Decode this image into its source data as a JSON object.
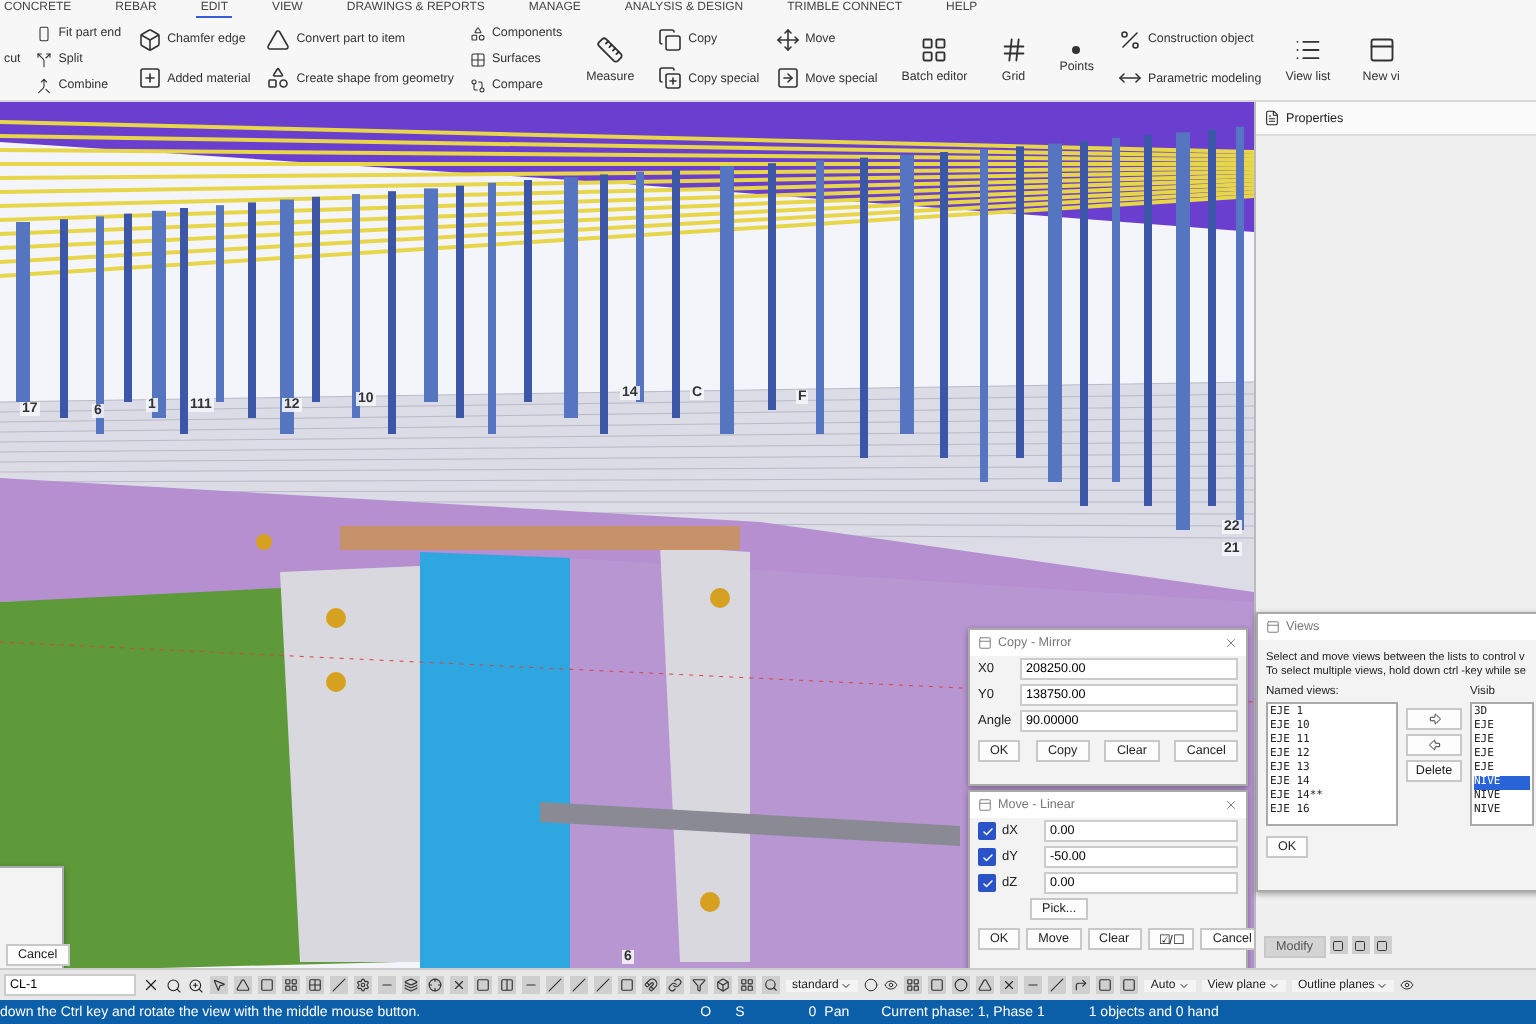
{
  "ribbon": {
    "tabs": [
      {
        "label": "CONCRETE",
        "selected": false
      },
      {
        "label": "REBAR",
        "selected": false
      },
      {
        "label": "EDIT",
        "selected": true
      },
      {
        "label": "VIEW",
        "selected": false
      },
      {
        "label": "DRAWINGS & REPORTS",
        "selected": false
      },
      {
        "label": "MANAGE",
        "selected": false
      },
      {
        "label": "ANALYSIS & DESIGN",
        "selected": false
      },
      {
        "label": "TRIMBLE CONNECT",
        "selected": false
      },
      {
        "label": "HELP",
        "selected": false
      }
    ],
    "groups": [
      {
        "kind": "stack",
        "items": [
          "cut"
        ]
      },
      {
        "kind": "stack",
        "items": [
          "Fit part end",
          "Split",
          "Combine"
        ]
      },
      {
        "kind": "stack",
        "items": [
          "Chamfer edge",
          "Added material"
        ]
      },
      {
        "kind": "stack",
        "items": [
          "Convert part to item",
          "Create shape from geometry"
        ]
      },
      {
        "kind": "stack",
        "items": [
          "Components",
          "Surfaces",
          "Compare"
        ]
      },
      {
        "kind": "large",
        "items": [
          "Measure"
        ]
      },
      {
        "kind": "stack",
        "items": [
          "Copy",
          "Copy special"
        ]
      },
      {
        "kind": "stack",
        "items": [
          "Move",
          "Move special"
        ]
      },
      {
        "kind": "large",
        "items": [
          "Batch editor"
        ]
      },
      {
        "kind": "large",
        "items": [
          "Grid"
        ]
      },
      {
        "kind": "large",
        "items": [
          "Points"
        ]
      },
      {
        "kind": "stack",
        "items": [
          "Construction object",
          "Parametric modeling"
        ]
      },
      {
        "kind": "large",
        "items": [
          "View list"
        ]
      },
      {
        "kind": "large",
        "items": [
          "New vi"
        ]
      }
    ]
  },
  "grid_labels": [
    "17",
    "6",
    "1",
    "111",
    "12",
    "10",
    "14",
    "C",
    "F",
    "22",
    "21",
    "6"
  ],
  "copy_mirror": {
    "title": "Copy - Mirror",
    "fields": [
      {
        "label": "X0",
        "value": "208250.00"
      },
      {
        "label": "Y0",
        "value": "138750.00"
      },
      {
        "label": "Angle",
        "value": "90.00000"
      }
    ],
    "buttons": [
      "OK",
      "Copy",
      "Clear",
      "Cancel"
    ]
  },
  "move_linear": {
    "title": "Move - Linear",
    "fields": [
      {
        "label": "dX",
        "value": "0.00",
        "checked": true
      },
      {
        "label": "dY",
        "value": "-50.00",
        "checked": true
      },
      {
        "label": "dZ",
        "value": "0.00",
        "checked": true
      }
    ],
    "pick": "Pick...",
    "buttons": [
      "OK",
      "Move",
      "Clear",
      "☑/☐",
      "Cancel"
    ]
  },
  "left_dialog": {
    "button": "Cancel"
  },
  "properties": {
    "title": "Properties"
  },
  "views": {
    "title": "Views",
    "description": [
      "Select and move views between the lists to control v",
      "To select multiple views, hold down ctrl -key while se"
    ],
    "named_label": "Named views:",
    "named": [
      "EJE 1",
      "EJE 10",
      "EJE 11",
      "EJE 12",
      "EJE 13",
      "EJE 14",
      "EJE 14**",
      "EJE 16"
    ],
    "delete": "Delete",
    "visible_label": "Visib",
    "visible": [
      {
        "label": "3D",
        "selected": false
      },
      {
        "label": "EJE",
        "selected": false
      },
      {
        "label": "EJE",
        "selected": false
      },
      {
        "label": "EJE",
        "selected": false
      },
      {
        "label": "EJE",
        "selected": false
      },
      {
        "label": "NIVE",
        "selected": true
      },
      {
        "label": "NIVE",
        "selected": false
      },
      {
        "label": "NIVE",
        "selected": false
      }
    ],
    "ok": "OK",
    "modify": "Modify"
  },
  "toolbar": {
    "filter": "CL-1",
    "dropdowns": [
      "standard",
      "Auto",
      "View plane",
      "Outline planes"
    ]
  },
  "status_bar": {
    "message": "down the Ctrl key and rotate the view with the middle mouse button.",
    "o": "O",
    "s": "S",
    "count": "0",
    "mode": "Pan",
    "phase": "Current phase: 1, Phase 1",
    "selection": "1 objects and 0 hand"
  }
}
